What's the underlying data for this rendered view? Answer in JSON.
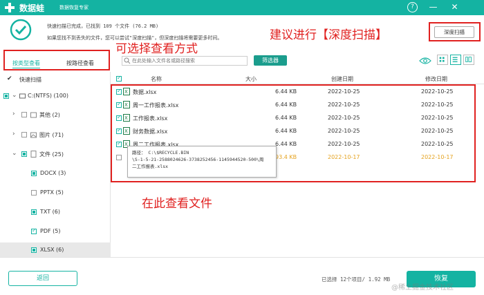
{
  "app": {
    "brand": "数据蛙",
    "subtitle": "数据恢复专家",
    "accent_color": "#14b3a2",
    "annotation_color": "#e0201f"
  },
  "window_controls": {
    "help": "?",
    "minimize": "—",
    "close": "✕"
  },
  "status": {
    "line1": "快速扫描已完成，已找到 109 个文件 (76.2 MB)",
    "line2": "如果您找不到丢失的文件，您可以尝试\"深度扫描\"，但深度扫描将需要更多时间。"
  },
  "deep_scan_button": "深度扫描",
  "annotations": {
    "deep_scan": "建议进行【深度扫描】",
    "view_mode": "可选择查看方式",
    "view_files": "在此查看文件"
  },
  "view_tabs": {
    "by_type": "按类型查看",
    "by_path": "按路径查看"
  },
  "search": {
    "placeholder": "在此处输入文件名或路径搜索"
  },
  "filter_button": "筛选器",
  "icons": {
    "eye": "eye-icon",
    "grid_view": "grid-view-icon",
    "list_view": "list-view-icon",
    "detail_view": "detail-view-icon",
    "search": "search-icon",
    "check": "check-circle-icon"
  },
  "tree": {
    "quick_scan": "快速扫描",
    "drive": "C:(NTFS) (100)",
    "others": "其他 (2)",
    "images": "图片 (71)",
    "documents": "文件 (25)",
    "docx": "DOCX (3)",
    "pptx": "PPTX (5)",
    "txt": "TXT (6)",
    "pdf": "PDF (5)",
    "xlsx": "XLSX (6)"
  },
  "table": {
    "headers": {
      "name": "名称",
      "size": "大小",
      "created": "创建日期",
      "modified": "修改日期"
    },
    "rows": [
      {
        "name": "数据.xlsx",
        "size": "6.44 KB",
        "created": "2022-10-25",
        "modified": "2022-10-25"
      },
      {
        "name": "周一工作报表.xlsx",
        "size": "6.44 KB",
        "created": "2022-10-25",
        "modified": "2022-10-25"
      },
      {
        "name": "工作报表.xlsx",
        "size": "6.44 KB",
        "created": "2022-10-25",
        "modified": "2022-10-25"
      },
      {
        "name": "财务数据.xlsx",
        "size": "6.44 KB",
        "created": "2022-10-25",
        "modified": "2022-10-25"
      },
      {
        "name": "周二工作报表.xlsx",
        "size": "6.44 KB",
        "created": "2022-10-25",
        "modified": "2022-10-25"
      },
      {
        "name": "",
        "size": "93.4 KB",
        "created": "2022-10-17",
        "modified": "2022-10-17"
      }
    ]
  },
  "tooltip": {
    "line1": "路径： C:\\$RECYCLE.BIN",
    "line2": "\\S-1-5-21-2588024626-3738252456-1145944520-500\\周",
    "line3": "二工作报表.xlsx"
  },
  "footer": {
    "back": "返回",
    "summary": "已选择 12个项目/ 1.92 MB",
    "recover": "恢复",
    "watermark": "@稀土掘金技术社区"
  }
}
